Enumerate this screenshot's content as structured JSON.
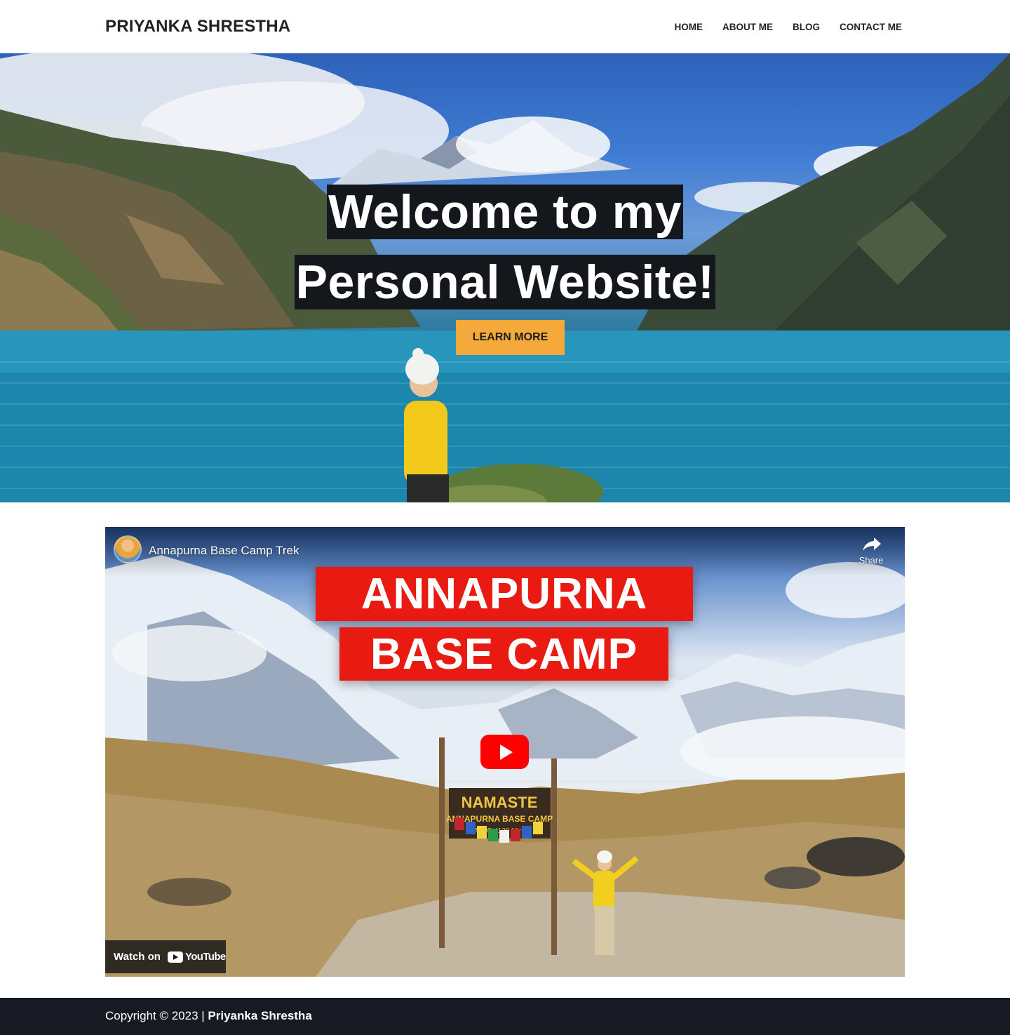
{
  "header": {
    "brand": "PRIYANKA SHRESTHA",
    "nav": [
      "HOME",
      "ABOUT ME",
      "BLOG",
      "CONTACT ME"
    ]
  },
  "hero": {
    "title_line1": "Welcome to my",
    "title_line2": "Personal Website!",
    "cta_label": "LEARN MORE",
    "cta_color": "#f5a93a"
  },
  "video": {
    "title": "Annapurna Base Camp Trek",
    "share_label": "Share",
    "banner_line1": "ANNAPURNA",
    "banner_line2": "BASE CAMP",
    "sign_line1": "NAMASTE",
    "sign_line2": "ANNAPURNA BASE CAMP",
    "sign_line3": "(A.B.C 4130 Mtrs)",
    "watch_on_label": "Watch on",
    "platform_name": "YouTube",
    "play_color": "#ff0000",
    "banner_color": "#e81a12"
  },
  "footer": {
    "copyright": "Copyright © 2023 |",
    "name": "Priyanka Shrestha",
    "background": "#171a22"
  }
}
